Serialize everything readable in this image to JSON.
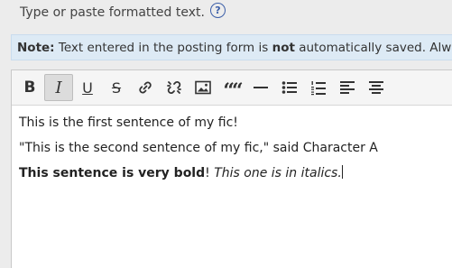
{
  "hint": {
    "text": "Type or paste formatted text.",
    "help_symbol": "?"
  },
  "note": {
    "label": "Note:",
    "text_before": " Text entered in the posting form is ",
    "emphasis": "not",
    "text_after": " automatically saved. Alwa"
  },
  "toolbar": {
    "bold": "B",
    "italic": "I",
    "underline": "U",
    "strike": "S",
    "quote": "““",
    "active": "italic"
  },
  "content": {
    "line1": "This is the first sentence of my fic!",
    "line2": "\"This is the second sentence of my fic,\" said Character A",
    "line3_bold": "This sentence is very bold",
    "line3_plain": "! ",
    "line3_italic": "This one is in italics."
  }
}
